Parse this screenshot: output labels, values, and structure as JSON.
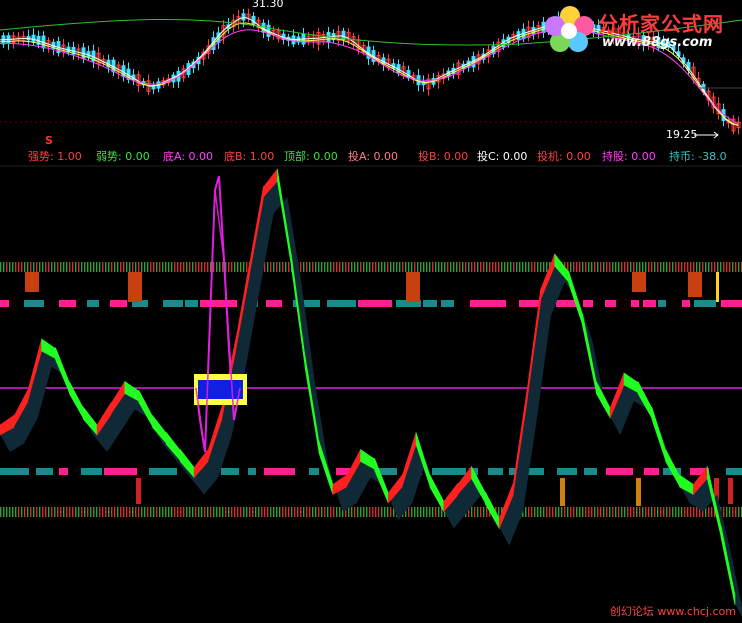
{
  "price_panel": {
    "high_label": "31.30",
    "low_label": "19.25"
  },
  "signal_marker": "S",
  "indicator_header": [
    {
      "text": "强势: 1.00",
      "color": "#ff4040"
    },
    {
      "text": "弱势: 0.00",
      "color": "#40e040"
    },
    {
      "text": "底A: 0.00",
      "color": "#ff40ff"
    },
    {
      "text": "底B: 1.00",
      "color": "#ff4040"
    },
    {
      "text": "顶部: 0.00",
      "color": "#40e040"
    },
    {
      "text": "投A: 0.00",
      "color": "#ff8080"
    },
    {
      "text": "投B: 0.00",
      "color": "#ff4040"
    },
    {
      "text": "投C: 0.00",
      "color": "#ffffff"
    },
    {
      "text": "投机: 0.00",
      "color": "#ff4040"
    },
    {
      "text": "持股: 0.00",
      "color": "#ff40ff"
    },
    {
      "text": "持币: -38.0",
      "color": "#40c0c0"
    }
  ],
  "logo": {
    "name": "分析家公式网",
    "url": "www.88gs.com"
  },
  "watermark": "创幻论坛 www.chcj.com",
  "colors": {
    "up": "#ff2020",
    "down": "#20ff20",
    "shadow": "#0f2a36",
    "magenta": "#e020e0",
    "teal": "#1a8a8a",
    "pink": "#ff2090",
    "orange": "#d04010"
  },
  "chart_data": {
    "type": "line",
    "title": "",
    "xlabel": "",
    "ylabel": "",
    "price_range_labels": {
      "high": 31.3,
      "low": 19.25
    },
    "series": [
      {
        "values": [
          0.4,
          0.42,
          0.48,
          0.6,
          0.58,
          0.5,
          0.44,
          0.4,
          0.45,
          0.5,
          0.48,
          0.42,
          0.38,
          0.34,
          0.3,
          0.34,
          0.44,
          0.6,
          0.78,
          0.96,
          1.0,
          0.8,
          0.56,
          0.36,
          0.26,
          0.28,
          0.34,
          0.32,
          0.24,
          0.28,
          0.38,
          0.28,
          0.22,
          0.26,
          0.3,
          0.24,
          0.18,
          0.26,
          0.48,
          0.72,
          0.8,
          0.76,
          0.66,
          0.5,
          0.44,
          0.52,
          0.5,
          0.44,
          0.34,
          0.28,
          0.26,
          0.3,
          0.16,
          0.0
        ]
      }
    ]
  }
}
